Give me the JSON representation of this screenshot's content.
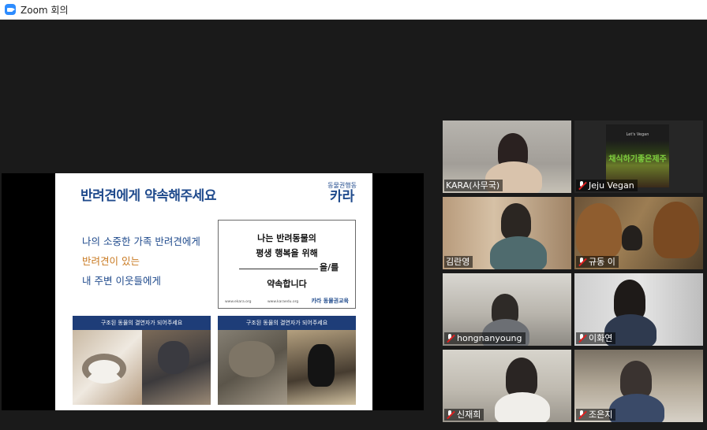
{
  "window": {
    "title": "Zoom 회의"
  },
  "slide": {
    "title": "반려견에게 약속해주세요",
    "brand_small": "동물권행동",
    "brand_big": "카라",
    "messages": [
      "나의 소중한 가족 반려견에게",
      "반려견이 있는",
      "내 주변 이웃들에게"
    ],
    "pledge": {
      "line1": "나는 반려동물의",
      "line2": "평생 행복을 위해",
      "line3": "을/를",
      "line4": "약속합니다",
      "url1": "www.ekara.org",
      "url2": "www.karaedu.org",
      "logo": "카라 동물권교육"
    },
    "cards": [
      {
        "heading": "구조된 동물의 결연자가 되어주세요"
      },
      {
        "heading": "구조된 동물의 결연자가 되어주세요"
      }
    ]
  },
  "participants": [
    {
      "name": "KARA(사무국)",
      "muted": false,
      "active": true
    },
    {
      "name": "Jeju Vegan",
      "muted": true,
      "active": false
    },
    {
      "name": "김란영",
      "muted": false,
      "active": false
    },
    {
      "name": "규동 이",
      "muted": true,
      "active": false
    },
    {
      "name": "hongnanyoung",
      "muted": true,
      "active": false
    },
    {
      "name": "이화연",
      "muted": true,
      "active": false
    },
    {
      "name": "신재희",
      "muted": true,
      "active": false
    },
    {
      "name": "조은지",
      "muted": true,
      "active": false
    }
  ],
  "jeju_sign": {
    "small": "Let's Vegan",
    "text": "채식하기좋은제주"
  },
  "colors": {
    "active_speaker": "#c8e060",
    "slide_blue": "#1f4a8c",
    "slide_orange": "#c8781f",
    "muted_red": "#e02020"
  }
}
